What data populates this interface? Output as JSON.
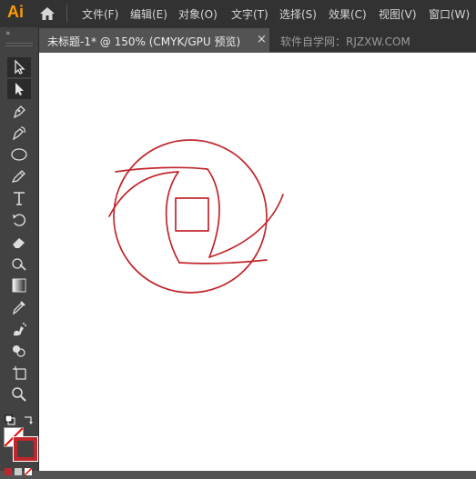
{
  "app": {
    "logo": "Ai"
  },
  "menu": [
    "文件(F)",
    "编辑(E)",
    "对象(O)",
    "文字(T)",
    "选择(S)",
    "效果(C)",
    "视图(V)",
    "窗口(W)"
  ],
  "document_tab": {
    "title": "未标题-1* @ 150% (CMYK/GPU 预览)",
    "close": "×"
  },
  "watermark": "软件自学网：RJZXW.COM",
  "toolbar": {
    "collapse": "»",
    "tools": [
      "selection-tool",
      "direct-selection-tool",
      "pen-tool",
      "curvature-tool",
      "ellipse-tool",
      "pencil-tool",
      "type-tool",
      "rotate-tool",
      "eraser-tool",
      "puppet-warp-tool",
      "gradient-tool",
      "eyedropper-tool",
      "symbol-sprayer-tool",
      "shape-builder-tool",
      "artboard-tool",
      "zoom-tool"
    ]
  },
  "colors": {
    "stroke": "#c0272d",
    "fill": "none",
    "menubar": "#323232",
    "toolbar": "#424242"
  }
}
